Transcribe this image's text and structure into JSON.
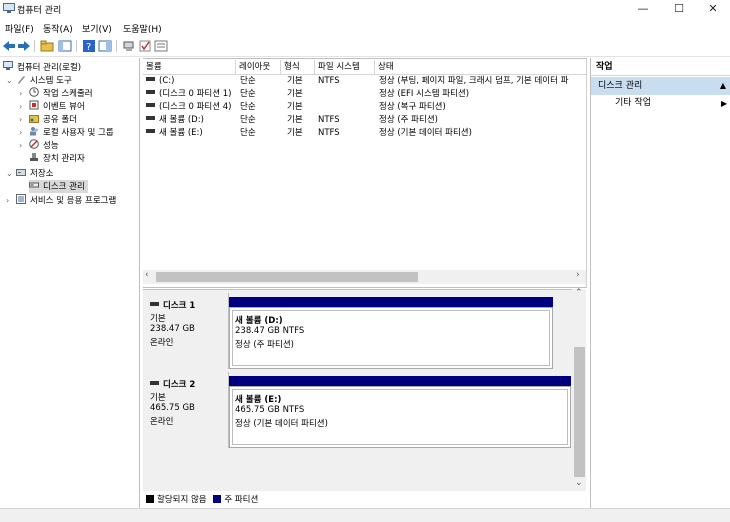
{
  "window": {
    "title": "컴퓨터 관리",
    "minimize": "—",
    "maximize": "☐",
    "close": "✕"
  },
  "menu": [
    "파일(F)",
    "동작(A)",
    "보기(V)",
    "도움말(H)"
  ],
  "tree": {
    "root": "컴퓨터 관리(로컬)",
    "system_tools": "시스템 도구",
    "task_scheduler": "작업 스케줄러",
    "event_viewer": "이벤트 뷰어",
    "shared_folders": "공유 폴더",
    "local_users": "로컬 사용자 및 그룹",
    "performance": "성능",
    "device_manager": "장치 관리자",
    "storage": "저장소",
    "disk_management": "디스크 관리",
    "services": "서비스 및 응용 프로그램"
  },
  "volumes": {
    "columns": [
      "볼륨",
      "레이아웃",
      "형식",
      "파일 시스템",
      "상태"
    ],
    "rows": [
      {
        "name": "(C:)",
        "layout": "단순",
        "type": "기본",
        "fs": "NTFS",
        "status": "정상 (부팅, 페이지 파일, 크래시 덤프, 기본 데이터 파"
      },
      {
        "name": "(디스크 0 파티션 1)",
        "layout": "단순",
        "type": "기본",
        "fs": "",
        "status": "정상 (EFI 시스템 파티션)"
      },
      {
        "name": "(디스크 0 파티션 4)",
        "layout": "단순",
        "type": "기본",
        "fs": "",
        "status": "정상 (복구 파티션)"
      },
      {
        "name": "새 볼륨 (D:)",
        "layout": "단순",
        "type": "기본",
        "fs": "NTFS",
        "status": "정상 (주 파티션)"
      },
      {
        "name": "새 볼륨 (E:)",
        "layout": "단순",
        "type": "기본",
        "fs": "NTFS",
        "status": "정상 (기본 데이터 파티션)"
      }
    ]
  },
  "disks": [
    {
      "name": "디스크 1",
      "kind": "기본",
      "size": "238.47 GB",
      "state": "온라인",
      "partition": {
        "title": "새 볼륨  (D:)",
        "detail": "238.47 GB NTFS",
        "status": "정상 (주 파티션)"
      }
    },
    {
      "name": "디스크 2",
      "kind": "기본",
      "size": "465.75 GB",
      "state": "온라인",
      "partition": {
        "title": "새 볼륨  (E:)",
        "detail": "465.75 GB NTFS",
        "status": "정상 (기본 데이터 파티션)"
      }
    }
  ],
  "legend": {
    "unallocated": "할당되지 않음",
    "primary": "주 파티션"
  },
  "actions": {
    "header": "작업",
    "selected": "디스크 관리",
    "more": "기타 작업"
  },
  "colors": {
    "primary_partition": "#00007f",
    "unallocated": "#000000",
    "selected_action": "#c9ddf1"
  }
}
